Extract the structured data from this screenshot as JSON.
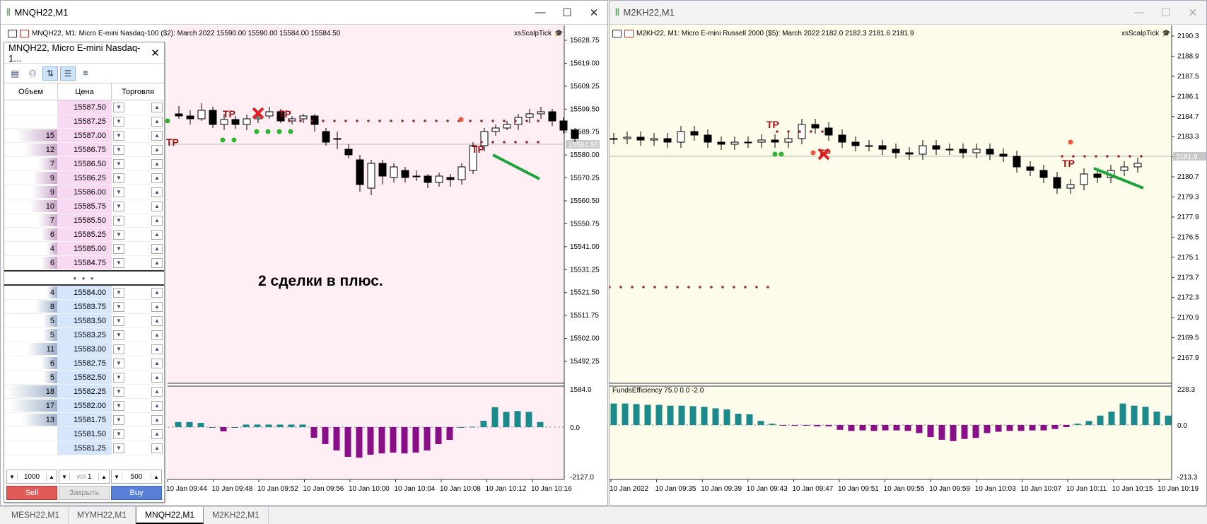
{
  "left_window": {
    "title": "MNQH22,M1",
    "header": "MNQH22, M1:  Micro E-mini Nasdaq-100 ($2): March 2022  15590.00 15590.00 15584.00 15584.50",
    "ea": "xsScalpTick",
    "annotation": "2 сделки в плюс.",
    "tp_label": "TP",
    "price_labels": [
      "15628.75",
      "15619.00",
      "15609.25",
      "15599.50",
      "15589.75",
      "15580.00",
      "15570.25",
      "15560.50",
      "15550.75",
      "15541.00",
      "15531.25",
      "15521.50",
      "15511.75",
      "15502.00",
      "15492.25"
    ],
    "current_price": "15584.50",
    "ind_labels": [
      "1584.0",
      "0.0",
      "-2127.0"
    ],
    "time_labels": [
      "10 Jan 09:44",
      "10 Jan 09:48",
      "10 Jan 09:52",
      "10 Jan 09:56",
      "10 Jan 10:00",
      "10 Jan 10:04",
      "10 Jan 10:08",
      "10 Jan 10:12",
      "10 Jan 10:16"
    ]
  },
  "right_window": {
    "title": "M2KH22,M1",
    "header": "M2KH22, M1:  Micro E-mini Russell 2000 ($5): March 2022  2182.0 2182.3 2181.6 2181.9",
    "ea": "xsScalpTick",
    "indicator": "FundsEfficiency 75.0 0.0 -2.0",
    "tp_label": "TP",
    "price_labels": [
      "2190.3",
      "2188.9",
      "2187.5",
      "2186.1",
      "2184.7",
      "2183.3",
      "2181.9",
      "2180.7",
      "2179.3",
      "2177.9",
      "2176.5",
      "2175.1",
      "2173.7",
      "2172.3",
      "2170.9",
      "2169.5",
      "2167.9"
    ],
    "current_price": "2181.9",
    "ind_labels": [
      "228.3",
      "0.0",
      "-213.3"
    ],
    "time_labels": [
      "10 Jan 2022",
      "10 Jan 09:35",
      "10 Jan 09:39",
      "10 Jan 09:43",
      "10 Jan 09:47",
      "10 Jan 09:51",
      "10 Jan 09:55",
      "10 Jan 09:59",
      "10 Jan 10:03",
      "10 Jan 10:07",
      "10 Jan 10:11",
      "10 Jan 10:15",
      "10 Jan 10:19"
    ]
  },
  "dom": {
    "title": "MNQH22, Micro E-mini Nasdaq-1...",
    "col_volume": "Объем",
    "col_price": "Цена",
    "col_trade": "Торговля",
    "sep": "• • •",
    "asks": [
      {
        "vol": "",
        "price": "15587.50",
        "bar": 0
      },
      {
        "vol": "",
        "price": "15587.25",
        "bar": 0
      },
      {
        "vol": "15",
        "price": "15587.00",
        "bar": 0.83
      },
      {
        "vol": "12",
        "price": "15586.75",
        "bar": 0.67
      },
      {
        "vol": "7",
        "price": "15586.50",
        "bar": 0.39
      },
      {
        "vol": "9",
        "price": "15586.25",
        "bar": 0.5
      },
      {
        "vol": "9",
        "price": "15586.00",
        "bar": 0.5
      },
      {
        "vol": "10",
        "price": "15585.75",
        "bar": 0.56
      },
      {
        "vol": "7",
        "price": "15585.50",
        "bar": 0.39
      },
      {
        "vol": "6",
        "price": "15585.25",
        "bar": 0.33
      },
      {
        "vol": "4",
        "price": "15585.00",
        "bar": 0.22
      },
      {
        "vol": "6",
        "price": "15584.75",
        "bar": 0.33
      }
    ],
    "bids": [
      {
        "vol": "4",
        "price": "15584.00",
        "bar": 0.22
      },
      {
        "vol": "8",
        "price": "15583.75",
        "bar": 0.44
      },
      {
        "vol": "5",
        "price": "15583.50",
        "bar": 0.28
      },
      {
        "vol": "5",
        "price": "15583.25",
        "bar": 0.28
      },
      {
        "vol": "11",
        "price": "15583.00",
        "bar": 0.61
      },
      {
        "vol": "6",
        "price": "15582.75",
        "bar": 0.33
      },
      {
        "vol": "5",
        "price": "15582.50",
        "bar": 0.28
      },
      {
        "vol": "18",
        "price": "15582.25",
        "bar": 1.0
      },
      {
        "vol": "17",
        "price": "15582.00",
        "bar": 0.94
      },
      {
        "vol": "13",
        "price": "15581.75",
        "bar": 0.72
      },
      {
        "vol": "",
        "price": "15581.50",
        "bar": 0
      },
      {
        "vol": "",
        "price": "15581.25",
        "bar": 0
      }
    ],
    "lot_left": "1000",
    "lot_mid_label": "vol",
    "lot_mid": "1",
    "lot_right": "500",
    "sell": "Sell",
    "close": "Закрыть",
    "buy": "Buy"
  },
  "tabs": [
    "MESH22,M1",
    "MYMH22,M1",
    "MNQH22,M1",
    "M2KH22,M1"
  ],
  "active_tab": 2,
  "colors": {
    "left_bg": "#ffeef4",
    "right_bg": "#fdfbea",
    "ask_row": "#f7d9f2",
    "bid_row": "#d6e6fb",
    "pos_bar": "#1a8a8a",
    "neg_bar": "#8a0e8a",
    "dots": "#9b2b2b",
    "trend": "#1ea33b"
  }
}
